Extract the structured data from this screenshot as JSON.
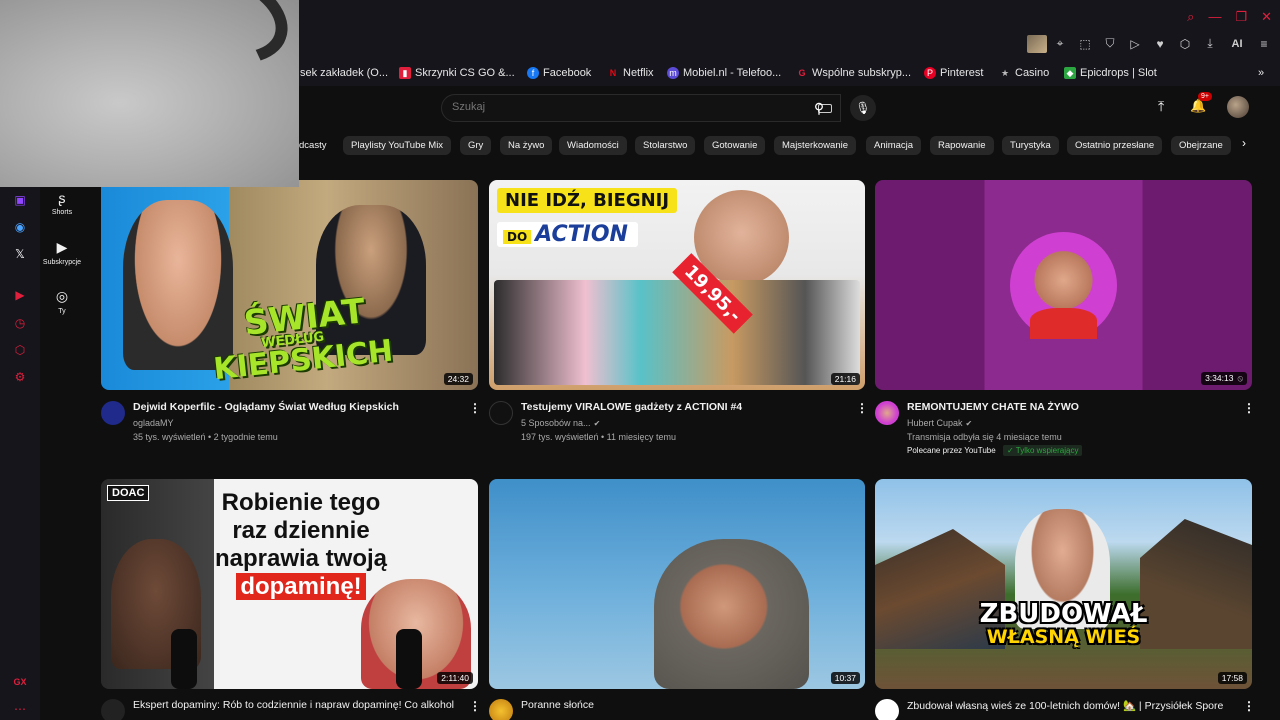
{
  "browser": {
    "bookmarks": [
      {
        "label": "sek zakładek (O...",
        "color": "#16151c"
      },
      {
        "label": "Skrzynki CS GO &...",
        "color": "#e01f3d"
      },
      {
        "label": "Facebook",
        "color": "#1877f2"
      },
      {
        "label": "Netflix",
        "color": "#e50914"
      },
      {
        "label": "Mobiel.nl - Telefoo...",
        "color": "#5b4bd6"
      },
      {
        "label": "Wspólne subskryp...",
        "color": "#e01f3d"
      },
      {
        "label": "Pinterest",
        "color": "#e60023"
      },
      {
        "label": "Casino",
        "color": "#888888"
      },
      {
        "label": "Epicdrops | Slot",
        "color": "#2ba640"
      }
    ],
    "ai_label": "AI"
  },
  "header": {
    "search_placeholder": "Szukaj",
    "notifications_badge": "9+"
  },
  "chips": [
    "dcasty",
    "Playlisty YouTube Mix",
    "Gry",
    "Na żywo",
    "Wiadomości",
    "Stolarstwo",
    "Gotowanie",
    "Majsterkowanie",
    "Animacja",
    "Rapowanie",
    "Turystyka",
    "Ostatnio przesłane",
    "Obejrzane"
  ],
  "yt_sidebar": {
    "shorts": "Shorts",
    "subscriptions": "Subskrypcje",
    "you": "Ty"
  },
  "gx_label": "GX",
  "videos": [
    {
      "title": "Dejwid Koperfilc - Oglądamy Świat Według Kiepskich",
      "channel": "ogladaMY",
      "meta": "35 tys. wyświetleń • 2 tygodnie temu",
      "duration": "24:32",
      "thumb_text_main": "ŚWIAT",
      "thumb_text_small": "WEDŁUG",
      "thumb_text_bottom": "KIEPSKICH"
    },
    {
      "title": "Testujemy VIRALOWE gadżety z ACTIONI #4",
      "channel": "5 Sposobów na...",
      "meta": "197 tys. wyświetleń • 11 miesięcy temu",
      "duration": "21:16",
      "thumb_banner": "NIE IDŹ, BIEGNIJ",
      "thumb_do": "DO",
      "thumb_action": "ACTION",
      "thumb_price": "19,95,-"
    },
    {
      "title": "REMONTUJEMY CHATE NA ŻYWO",
      "channel": "Hubert Cupak",
      "meta": "Transmisja odbyła się 4 miesiące temu",
      "promo": "Polecane przez YouTube",
      "members": "Tylko wspierający",
      "duration": "3:34:13"
    },
    {
      "title": "Ekspert dopaminy: Rób to codziennie i napraw dopaminę! Co alkohol",
      "duration": "2:11:40",
      "thumb_badge": "DOAC",
      "thumb_line1": "Robienie tego",
      "thumb_line2": "raz dziennie",
      "thumb_line3": "naprawia twoją",
      "thumb_line4": "dopaminę!"
    },
    {
      "title": "Poranne słońce",
      "duration": "10:37"
    },
    {
      "title": "Zbudował własną wieś ze 100-letnich domów! 🏡 | Przysiółek Spore",
      "duration": "17:58",
      "thumb_line1": "ZBUDOWAŁ",
      "thumb_line2": "WŁASNĄ WIEŚ"
    }
  ]
}
